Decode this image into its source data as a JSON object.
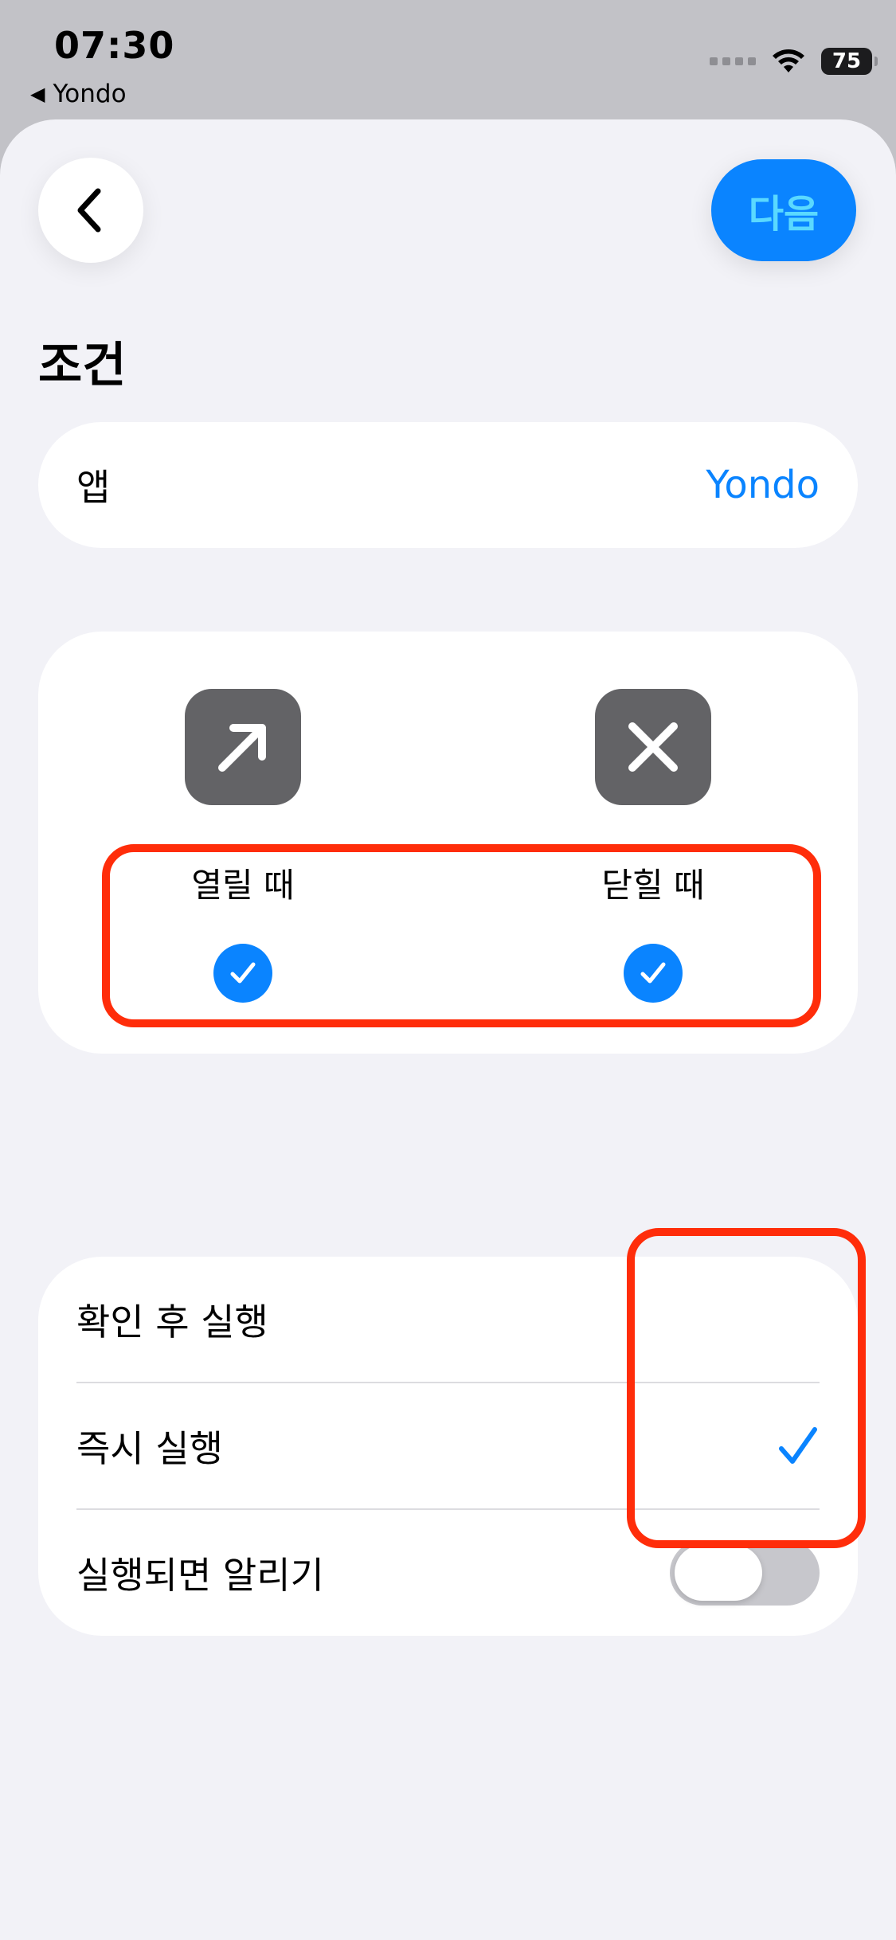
{
  "status_bar": {
    "time": "07:30",
    "back_app": "Yondo",
    "battery": "75"
  },
  "header": {
    "next_label": "다음",
    "section_title": "조건"
  },
  "app_row": {
    "label": "앱",
    "value": "Yondo"
  },
  "triggers": [
    {
      "label": "열릴 때",
      "icon": "arrow-up-right-icon",
      "checked": true
    },
    {
      "label": "닫힐 때",
      "icon": "close-icon",
      "checked": true
    }
  ],
  "options": {
    "confirm_run": "확인 후 실행",
    "instant_run": "즉시 실행",
    "notify_on_run": "실행되면 알리기",
    "selected": "instant_run",
    "notify_enabled": false
  },
  "colors": {
    "accent": "#0a84ff",
    "highlight": "#ff2d0a",
    "icon_bg": "#636366"
  }
}
